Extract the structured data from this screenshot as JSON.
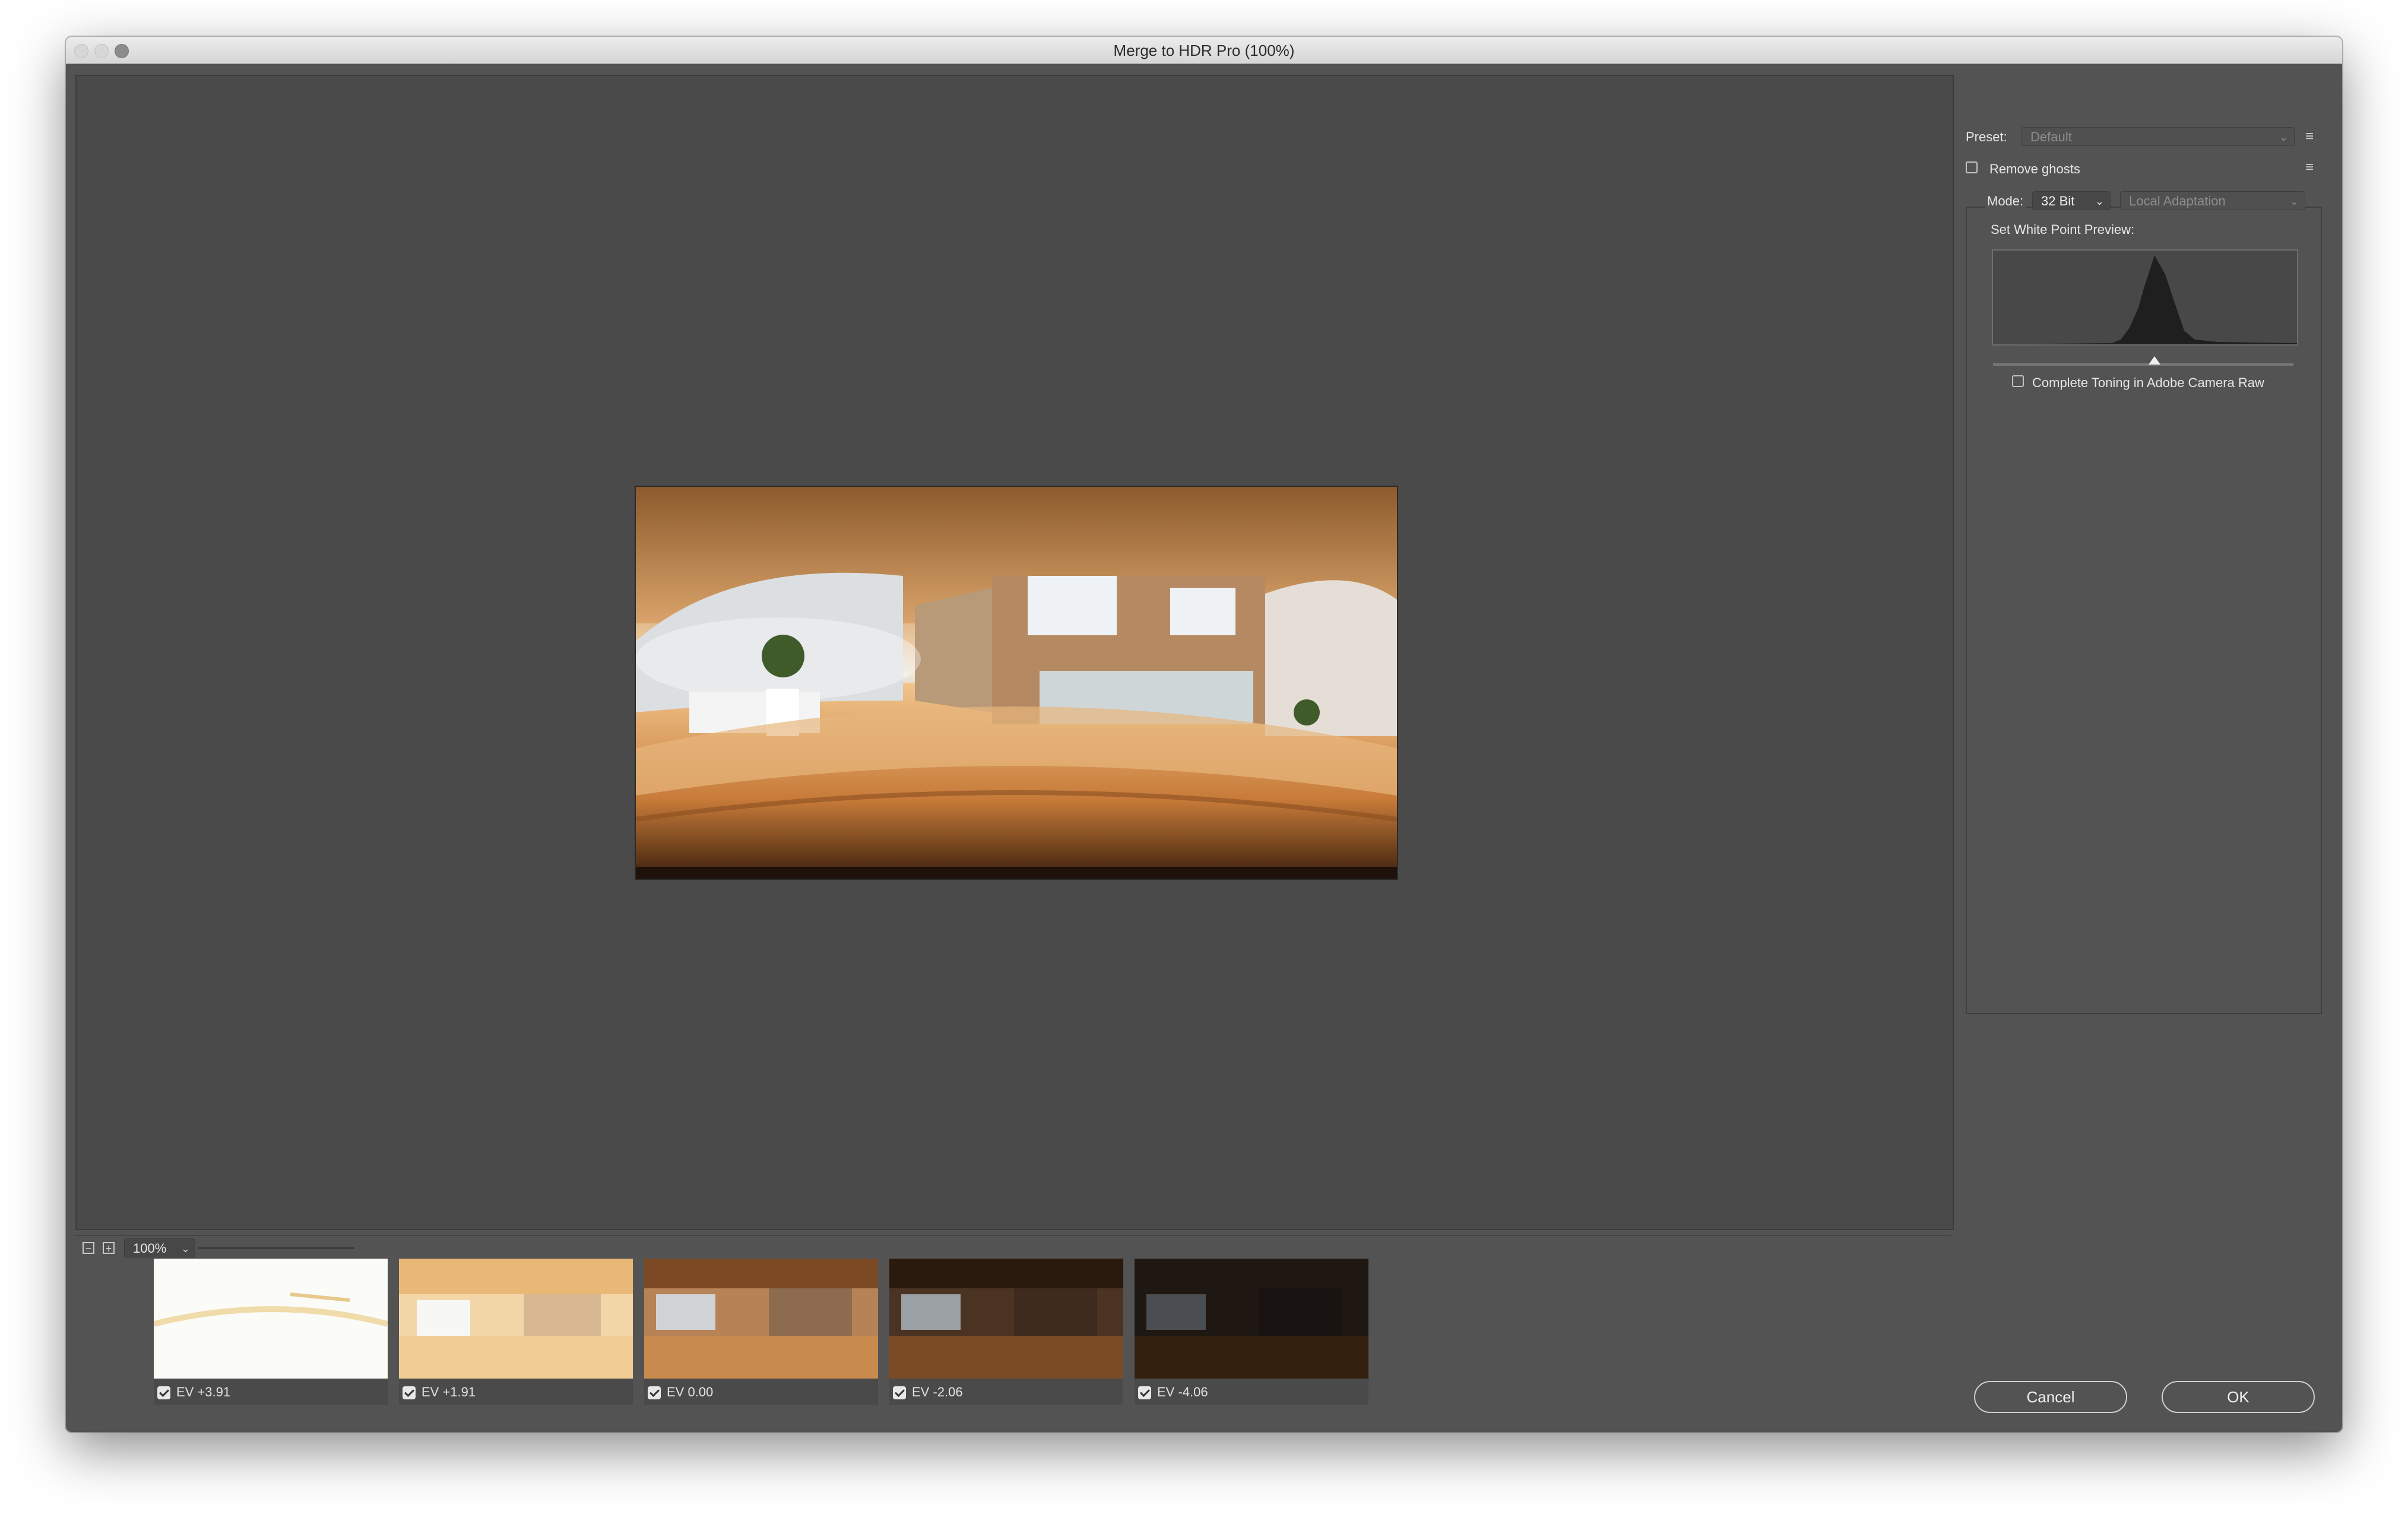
{
  "window": {
    "title": "Merge to HDR Pro (100%)"
  },
  "preview": {
    "zoom_value": "100%"
  },
  "thumbnails": [
    {
      "label": "EV +3.91",
      "checked": true
    },
    {
      "label": "EV +1.91",
      "checked": true
    },
    {
      "label": "EV 0.00",
      "checked": true
    },
    {
      "label": "EV -2.06",
      "checked": true
    },
    {
      "label": "EV -4.06",
      "checked": true
    }
  ],
  "settings": {
    "preset_label": "Preset:",
    "preset_value": "Default",
    "remove_ghosts_label": "Remove ghosts",
    "remove_ghosts_checked": false,
    "mode_label": "Mode:",
    "mode_value": "32 Bit",
    "method_value": "Local Adaptation",
    "white_point_label": "Set White Point Preview:",
    "complete_toning_label": "Complete Toning in Adobe Camera Raw",
    "complete_toning_checked": false
  },
  "buttons": {
    "cancel": "Cancel",
    "ok": "OK"
  },
  "icons": {
    "zoom_out": "zoom-out-icon",
    "zoom_in": "zoom-in-icon",
    "panel_menu": "panel-menu-icon",
    "chevron": "chevron-down-icon"
  },
  "colors": {
    "dialog_bg": "#535353",
    "preview_bg": "#4a4a4a"
  }
}
